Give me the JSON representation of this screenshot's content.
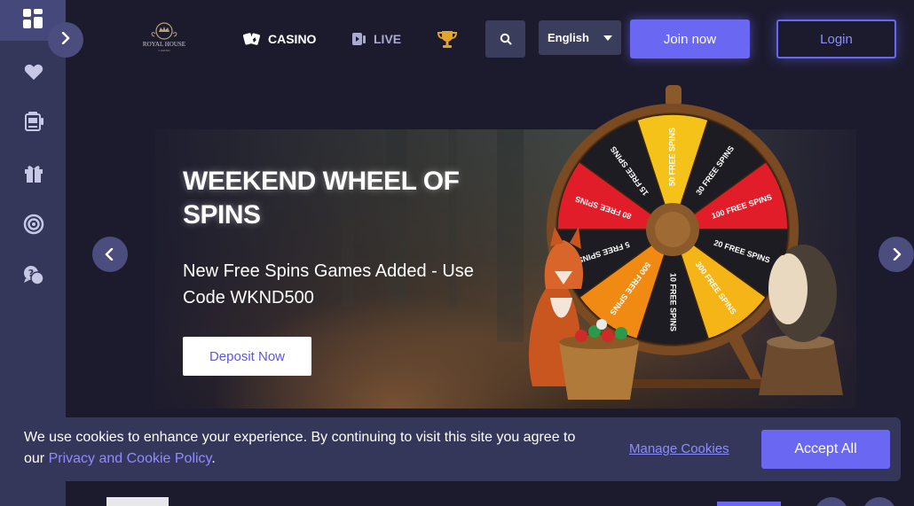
{
  "header": {
    "logo_text": "ROYAL HOUSE",
    "logo_sub": "CASINO",
    "nav": [
      {
        "label": "CASINO",
        "icon": "cards-icon"
      },
      {
        "label": "LIVE",
        "icon": "live-cards-icon"
      },
      {
        "label": "",
        "icon": "trophy-icon"
      }
    ],
    "language": "English",
    "join_label": "Join now",
    "login_label": "Login"
  },
  "sidebar": {
    "items": [
      {
        "icon": "dashboard-icon"
      },
      {
        "icon": "heart-icon"
      },
      {
        "icon": "slot-machine-icon"
      },
      {
        "icon": "gift-icon"
      },
      {
        "icon": "target-icon"
      },
      {
        "icon": "help-chat-icon"
      }
    ]
  },
  "banner": {
    "title": "WEEKEND WHEEL OF SPINS",
    "subtitle": "New Free Spins Games Added - Use Code WKND500",
    "cta_label": "Deposit Now",
    "wheel_segments": [
      "50 FREE SPINS",
      "30 FREE SPINS",
      "100 FREE SPINS",
      "20 FREE SPINS",
      "300 FREE SPINS",
      "10 FREE SPINS",
      "500 FREE SPINS",
      "5 FREE SPINS",
      "80 FREE SPINS",
      "15 FREE SPINS"
    ]
  },
  "cookie": {
    "text_before": "We use cookies to enhance your experience. By continuing to visit this site you agree to our ",
    "link_label": "Privacy and Cookie Policy",
    "text_after": ".",
    "manage_label": "Manage Cookies",
    "accept_label": "Accept All"
  },
  "colors": {
    "accent": "#6a68f2",
    "background": "#1c1b2e",
    "sidebar": "#34365a"
  }
}
